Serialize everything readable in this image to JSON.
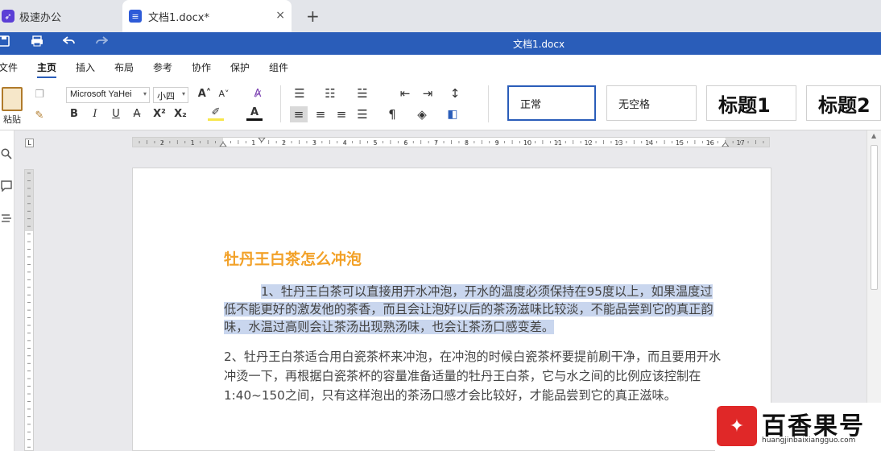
{
  "tabs": {
    "home_label": "极速办公",
    "doc_label": "文档1.docx*",
    "close_symbol": "×",
    "add_symbol": "+"
  },
  "titlebar": {
    "title": "文档1.docx"
  },
  "menu": {
    "items": [
      "文件",
      "主页",
      "插入",
      "布局",
      "参考",
      "协作",
      "保护",
      "组件"
    ],
    "active": "主页"
  },
  "ribbon": {
    "paste_label": "粘贴",
    "font_name": "Microsoft YaHei",
    "font_size": "小四",
    "styles": [
      "正常",
      "无空格",
      "标题1",
      "标题2"
    ],
    "selected_style": "正常"
  },
  "ruler": {
    "h_labels": [
      "2",
      "1",
      "1",
      "2",
      "3",
      "4",
      "5",
      "6",
      "7",
      "8",
      "9",
      "10",
      "11",
      "12",
      "13",
      "14",
      "15",
      "16",
      "17"
    ]
  },
  "document": {
    "heading": "牡丹王白茶怎么冲泡",
    "para1": "1、牡丹王白茶可以直接用开水冲泡，开水的温度必须保持在95度以上，如果温度过低不能更好的激发他的茶香，而且会让泡好以后的茶汤滋味比较淡，不能品尝到它的真正韵味，水温过高则会让茶汤出现熟汤味，也会让茶汤口感变差。",
    "para2": "2、牡丹王白茶适合用白瓷茶杯来冲泡，在冲泡的时候白瓷茶杯要提前刷干净，而且要用开水冲烫一下，再根据白瓷茶杯的容量准备适量的牡丹王白茶，它与水之间的比例应该控制在1:40~150之间，只有这样泡出的茶汤口感才会比较好，才能品尝到它的真正滋味。"
  },
  "watermark": {
    "name": "百香果号",
    "url": "huangjinbaixiangguo.com"
  },
  "colors": {
    "accent": "#2a5db9",
    "heading": "#f2a128",
    "selection": "#c9d6ee"
  }
}
